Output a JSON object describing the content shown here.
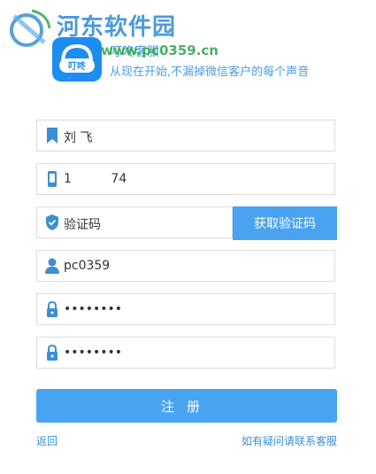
{
  "watermark": {
    "title": "河东软件园",
    "url": "www.pc0359.cn"
  },
  "header": {
    "app_name": "叮咚客服",
    "slogan": "从现在开始,不漏掉微信客户的每个声音"
  },
  "form": {
    "name": {
      "value": "刘 飞",
      "icon": "bookmark-icon"
    },
    "phone": {
      "value": "1          74",
      "icon": "phone-icon"
    },
    "code": {
      "placeholder": "验证码",
      "icon": "shield-check-icon",
      "button_label": "获取验证码"
    },
    "username": {
      "value": "pc0359",
      "icon": "user-icon"
    },
    "password": {
      "value": "••••••••",
      "icon": "lock-icon"
    },
    "password_confirm": {
      "value": "••••••••",
      "icon": "lock-icon"
    },
    "submit_label": "注册"
  },
  "footer": {
    "back_label": "返回",
    "help_label": "如有疑问请联系客服"
  },
  "colors": {
    "accent": "#4aa3f0",
    "link": "#3a8fd6",
    "border": "#dcdcdc"
  }
}
